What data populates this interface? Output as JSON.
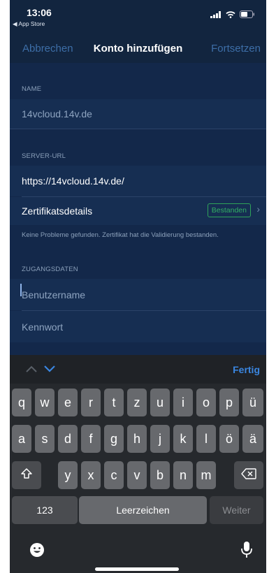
{
  "status": {
    "time": "13:06",
    "back_app": "◀ App Store"
  },
  "nav": {
    "cancel": "Abbrechen",
    "title": "Konto hinzufügen",
    "continue": "Fortsetzen"
  },
  "name_section": {
    "label": "NAME",
    "value": "14vcloud.14v.de"
  },
  "server_section": {
    "label": "SERVER-URL",
    "value": "https://14vcloud.14v.de/",
    "cert_label": "Zertifikatsdetails",
    "cert_badge": "Bestanden",
    "note": "Keine Probleme gefunden. Zertifikat hat die Validierung bestanden."
  },
  "credentials_section": {
    "label": "ZUGANGSDATEN",
    "username_placeholder": "Benutzername",
    "password_placeholder": "Kennwort"
  },
  "keyboard": {
    "done": "Fertig",
    "row1": [
      "q",
      "w",
      "e",
      "r",
      "t",
      "z",
      "u",
      "i",
      "o",
      "p",
      "ü"
    ],
    "row2": [
      "a",
      "s",
      "d",
      "f",
      "g",
      "h",
      "j",
      "k",
      "l",
      "ö",
      "ä"
    ],
    "row3": [
      "y",
      "x",
      "c",
      "v",
      "b",
      "n",
      "m"
    ],
    "numbers": "123",
    "space": "Leerzeichen",
    "next": "Weiter"
  },
  "colors": {
    "accent": "#3d6ea7",
    "badge_green": "#32b164",
    "done_blue": "#3a86e0"
  }
}
